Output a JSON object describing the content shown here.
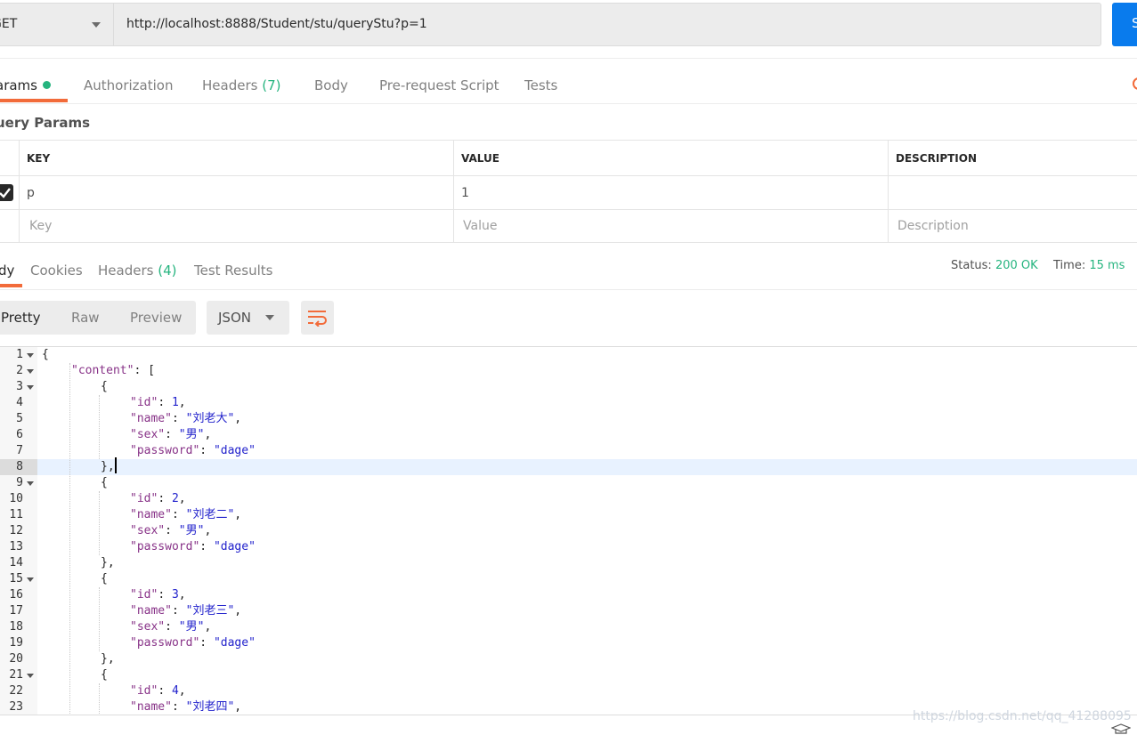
{
  "request": {
    "method": "GET",
    "url": "http://localhost:8888/Student/stu/queryStu?p=1",
    "send_label": "S"
  },
  "request_tabs": {
    "params": "arams",
    "authorization": "Authorization",
    "headers": "Headers",
    "headers_count": "(7)",
    "body": "Body",
    "prerequest": "Pre-request Script",
    "tests": "Tests"
  },
  "query_params": {
    "title": "uery Params",
    "headers": {
      "key": "KEY",
      "value": "VALUE",
      "description": "DESCRIPTION"
    },
    "row": {
      "key": "p",
      "value": "1",
      "description": ""
    },
    "placeholders": {
      "key": "Key",
      "value": "Value",
      "description": "Description"
    }
  },
  "response_tabs": {
    "body": "dy",
    "cookies": "Cookies",
    "headers": "Headers",
    "headers_count": "(4)",
    "test_results": "Test Results"
  },
  "status": {
    "status_label": "Status:",
    "status_value": "200 OK",
    "time_label": "Time:",
    "time_value": "15 ms"
  },
  "view_modes": {
    "pretty": "Pretty",
    "raw": "Raw",
    "preview": "Preview"
  },
  "format": "JSON",
  "editor": {
    "highlighted_line": 8,
    "lines": [
      {
        "n": "1",
        "fold": true,
        "indent": 0,
        "t": [
          [
            "p",
            "{"
          ]
        ]
      },
      {
        "n": "2",
        "fold": true,
        "indent": 1,
        "t": [
          [
            "k",
            "\"content\""
          ],
          [
            "p",
            ": ["
          ]
        ]
      },
      {
        "n": "3",
        "fold": true,
        "indent": 2,
        "t": [
          [
            "p",
            "{"
          ]
        ]
      },
      {
        "n": "4",
        "fold": false,
        "indent": 3,
        "t": [
          [
            "k",
            "\"id\""
          ],
          [
            "p",
            ": "
          ],
          [
            "n",
            "1"
          ],
          [
            "p",
            ","
          ]
        ]
      },
      {
        "n": "5",
        "fold": false,
        "indent": 3,
        "t": [
          [
            "k",
            "\"name\""
          ],
          [
            "p",
            ": "
          ],
          [
            "s",
            "\"刘老大\""
          ],
          [
            "p",
            ","
          ]
        ]
      },
      {
        "n": "6",
        "fold": false,
        "indent": 3,
        "t": [
          [
            "k",
            "\"sex\""
          ],
          [
            "p",
            ": "
          ],
          [
            "s",
            "\"男\""
          ],
          [
            "p",
            ","
          ]
        ]
      },
      {
        "n": "7",
        "fold": false,
        "indent": 3,
        "t": [
          [
            "k",
            "\"password\""
          ],
          [
            "p",
            ": "
          ],
          [
            "s",
            "\"dage\""
          ]
        ]
      },
      {
        "n": "8",
        "fold": false,
        "indent": 2,
        "t": [
          [
            "p",
            "},"
          ]
        ]
      },
      {
        "n": "9",
        "fold": true,
        "indent": 2,
        "t": [
          [
            "p",
            "{"
          ]
        ]
      },
      {
        "n": "10",
        "fold": false,
        "indent": 3,
        "t": [
          [
            "k",
            "\"id\""
          ],
          [
            "p",
            ": "
          ],
          [
            "n",
            "2"
          ],
          [
            "p",
            ","
          ]
        ]
      },
      {
        "n": "11",
        "fold": false,
        "indent": 3,
        "t": [
          [
            "k",
            "\"name\""
          ],
          [
            "p",
            ": "
          ],
          [
            "s",
            "\"刘老二\""
          ],
          [
            "p",
            ","
          ]
        ]
      },
      {
        "n": "12",
        "fold": false,
        "indent": 3,
        "t": [
          [
            "k",
            "\"sex\""
          ],
          [
            "p",
            ": "
          ],
          [
            "s",
            "\"男\""
          ],
          [
            "p",
            ","
          ]
        ]
      },
      {
        "n": "13",
        "fold": false,
        "indent": 3,
        "t": [
          [
            "k",
            "\"password\""
          ],
          [
            "p",
            ": "
          ],
          [
            "s",
            "\"dage\""
          ]
        ]
      },
      {
        "n": "14",
        "fold": false,
        "indent": 2,
        "t": [
          [
            "p",
            "},"
          ]
        ]
      },
      {
        "n": "15",
        "fold": true,
        "indent": 2,
        "t": [
          [
            "p",
            "{"
          ]
        ]
      },
      {
        "n": "16",
        "fold": false,
        "indent": 3,
        "t": [
          [
            "k",
            "\"id\""
          ],
          [
            "p",
            ": "
          ],
          [
            "n",
            "3"
          ],
          [
            "p",
            ","
          ]
        ]
      },
      {
        "n": "17",
        "fold": false,
        "indent": 3,
        "t": [
          [
            "k",
            "\"name\""
          ],
          [
            "p",
            ": "
          ],
          [
            "s",
            "\"刘老三\""
          ],
          [
            "p",
            ","
          ]
        ]
      },
      {
        "n": "18",
        "fold": false,
        "indent": 3,
        "t": [
          [
            "k",
            "\"sex\""
          ],
          [
            "p",
            ": "
          ],
          [
            "s",
            "\"男\""
          ],
          [
            "p",
            ","
          ]
        ]
      },
      {
        "n": "19",
        "fold": false,
        "indent": 3,
        "t": [
          [
            "k",
            "\"password\""
          ],
          [
            "p",
            ": "
          ],
          [
            "s",
            "\"dage\""
          ]
        ]
      },
      {
        "n": "20",
        "fold": false,
        "indent": 2,
        "t": [
          [
            "p",
            "},"
          ]
        ]
      },
      {
        "n": "21",
        "fold": true,
        "indent": 2,
        "t": [
          [
            "p",
            "{"
          ]
        ]
      },
      {
        "n": "22",
        "fold": false,
        "indent": 3,
        "t": [
          [
            "k",
            "\"id\""
          ],
          [
            "p",
            ": "
          ],
          [
            "n",
            "4"
          ],
          [
            "p",
            ","
          ]
        ]
      },
      {
        "n": "23",
        "fold": false,
        "indent": 3,
        "t": [
          [
            "k",
            "\"name\""
          ],
          [
            "p",
            ": "
          ],
          [
            "s",
            "\"刘老四\""
          ],
          [
            "p",
            ","
          ]
        ]
      }
    ]
  },
  "watermark": "https://blog.csdn.net/qq_41288095",
  "colors": {
    "accent": "#f26b3a",
    "success": "#26b47f",
    "send": "#097bed"
  },
  "icons": {
    "wrap": "wrap-lines-icon",
    "check": "checkmark-icon",
    "caret": "chevron-down-icon",
    "cookies": "cookies-icon",
    "bootcamp": "bootcamp-icon"
  }
}
